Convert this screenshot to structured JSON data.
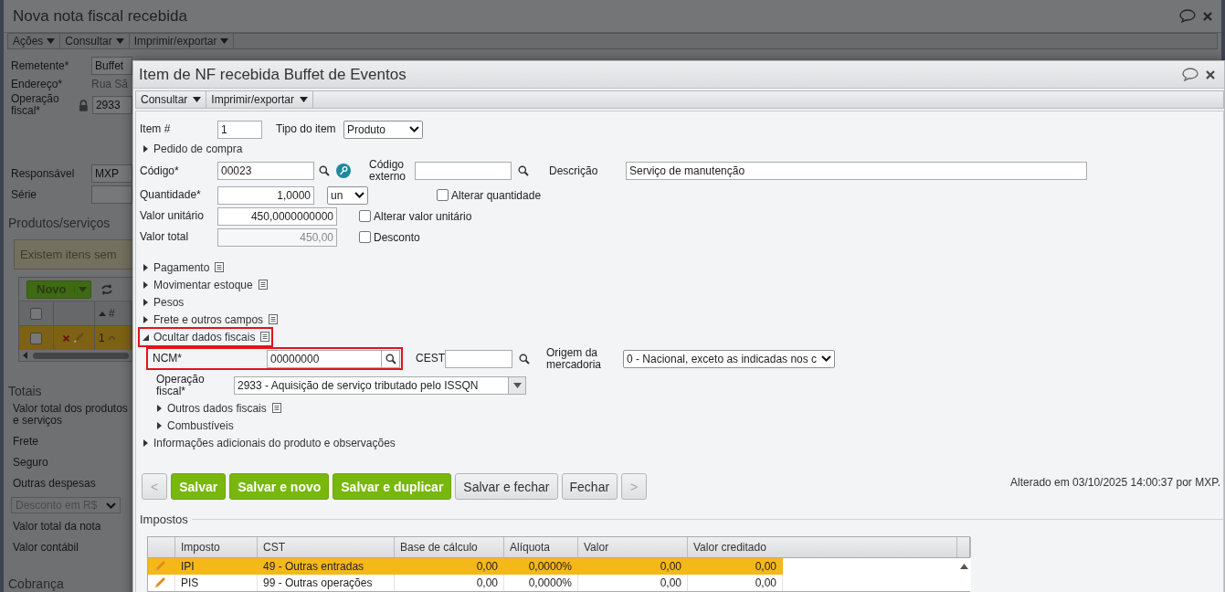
{
  "background_window": {
    "title": "Nova nota fiscal recebida",
    "menu": [
      {
        "label": "Ações"
      },
      {
        "label": "Consultar"
      },
      {
        "label": "Imprimir/exportar"
      }
    ],
    "header_fields": [
      {
        "kind": "input",
        "label": "Remetente*",
        "value": "Buffet"
      },
      {
        "kind": "text",
        "label": "Endereço*",
        "value": "Rua Sã"
      },
      {
        "kind": "locked",
        "label": "Operação fiscal*",
        "value": "2933"
      }
    ],
    "lower_fields": [
      {
        "kind": "input",
        "label": "Responsável",
        "value": "MXP"
      },
      {
        "kind": "input",
        "label": "Série"
      }
    ],
    "products": {
      "legend": "Produtos/serviços",
      "warning": "Existem itens sem",
      "new_button": "Novo",
      "sort_column": "#",
      "select_all_checked": false,
      "rows": [
        {
          "selected": true,
          "checked": false,
          "number": "1"
        }
      ]
    },
    "totals": {
      "legend": "Totais",
      "items": [
        {
          "kind": "label",
          "label": "Valor total dos produtos e serviços"
        },
        {
          "kind": "label",
          "label": "Frete"
        },
        {
          "kind": "label",
          "label": "Seguro"
        },
        {
          "kind": "label",
          "label": "Outras despesas"
        },
        {
          "kind": "select",
          "label": "Desconto em R$"
        },
        {
          "kind": "label",
          "label": "Valor total da nota"
        },
        {
          "kind": "label",
          "label": "Valor contábil"
        }
      ]
    },
    "next_legend": "Cobrança"
  },
  "dialog": {
    "title": "Item de NF recebida Buffet de Eventos",
    "menu": [
      {
        "label": "Consultar"
      },
      {
        "label": "Imprimir/exportar"
      }
    ],
    "item": {
      "label": "Item #",
      "value": "1"
    },
    "item_type": {
      "label": "Tipo do item",
      "value": "Produto"
    },
    "purchase_order": {
      "label": "Pedido de compra",
      "expanded": false
    },
    "code": {
      "label": "Código*",
      "value": "00023"
    },
    "external_code": {
      "label": "Código externo"
    },
    "description": {
      "label": "Descrição",
      "value": "Serviço de manutenção"
    },
    "quantity": {
      "label": "Quantidade*",
      "value": "1,0000",
      "unit": "un"
    },
    "change_quantity": {
      "label": "Alterar quantidade",
      "checked": false
    },
    "unit_value": {
      "label": "Valor unitário",
      "value": "450,0000000000"
    },
    "change_unit_value": {
      "label": "Alterar valor unitário",
      "checked": false
    },
    "total_value": {
      "label": "Valor total",
      "value": "450,00"
    },
    "discount": {
      "label": "Desconto",
      "checked": false
    },
    "sections": [
      {
        "label": "Pagamento",
        "expanded": false,
        "has_note": true
      },
      {
        "label": "Movimentar estoque",
        "expanded": false,
        "has_note": true
      },
      {
        "label": "Pesos",
        "expanded": false,
        "has_note": false
      },
      {
        "label": "Frete e outros campos",
        "expanded": false,
        "has_note": true
      },
      {
        "label": "Ocultar dados fiscais",
        "expanded": true,
        "has_note": true,
        "highlighted": true
      }
    ],
    "fiscal": {
      "ncm": {
        "label": "NCM*",
        "value": "00000000",
        "highlighted": true
      },
      "cest": {
        "label": "CEST"
      },
      "origin": {
        "label": "Origem da mercadoria",
        "value": "0 - Nacional, exceto as indicadas nos c"
      },
      "operation": {
        "label": "Operação fiscal*",
        "value": "2933 - Aquisição de serviço tributado pelo ISSQN"
      },
      "subsections": [
        {
          "label": "Outros dados fiscais",
          "expanded": false,
          "has_note": true
        },
        {
          "label": "Combustíveis",
          "expanded": false,
          "has_note": false
        }
      ]
    },
    "additional_info": {
      "label": "Informações adicionais do produto e observações",
      "expanded": false
    },
    "buttons": [
      {
        "kind": "nav",
        "label": "<",
        "disabled": true
      },
      {
        "kind": "primary",
        "label": "Salvar",
        "disabled": false
      },
      {
        "kind": "primary",
        "label": "Salvar e novo",
        "disabled": false
      },
      {
        "kind": "primary",
        "label": "Salvar e duplicar",
        "disabled": false
      },
      {
        "kind": "secondary",
        "label": "Salvar e fechar",
        "disabled": false
      },
      {
        "kind": "secondary",
        "label": "Fechar",
        "disabled": false
      },
      {
        "kind": "nav",
        "label": ">",
        "disabled": true
      }
    ],
    "modified": "Alterado em 03/10/2025 14:00:37 por MXP.",
    "taxes": {
      "legend": "Impostos",
      "columns": [
        "Imposto",
        "CST",
        "Base de cálculo",
        "Alíquota",
        "Valor",
        "Valor creditado"
      ],
      "rows": [
        {
          "selected": true,
          "cells": [
            "IPI",
            "49 - Outras entradas",
            "0,00",
            "0,0000%",
            "0,00",
            "0,00"
          ]
        },
        {
          "selected": false,
          "cells": [
            "PIS",
            "99 - Outras operações",
            "0,00",
            "0,0000%",
            "0,00",
            "0,00"
          ]
        }
      ]
    }
  }
}
